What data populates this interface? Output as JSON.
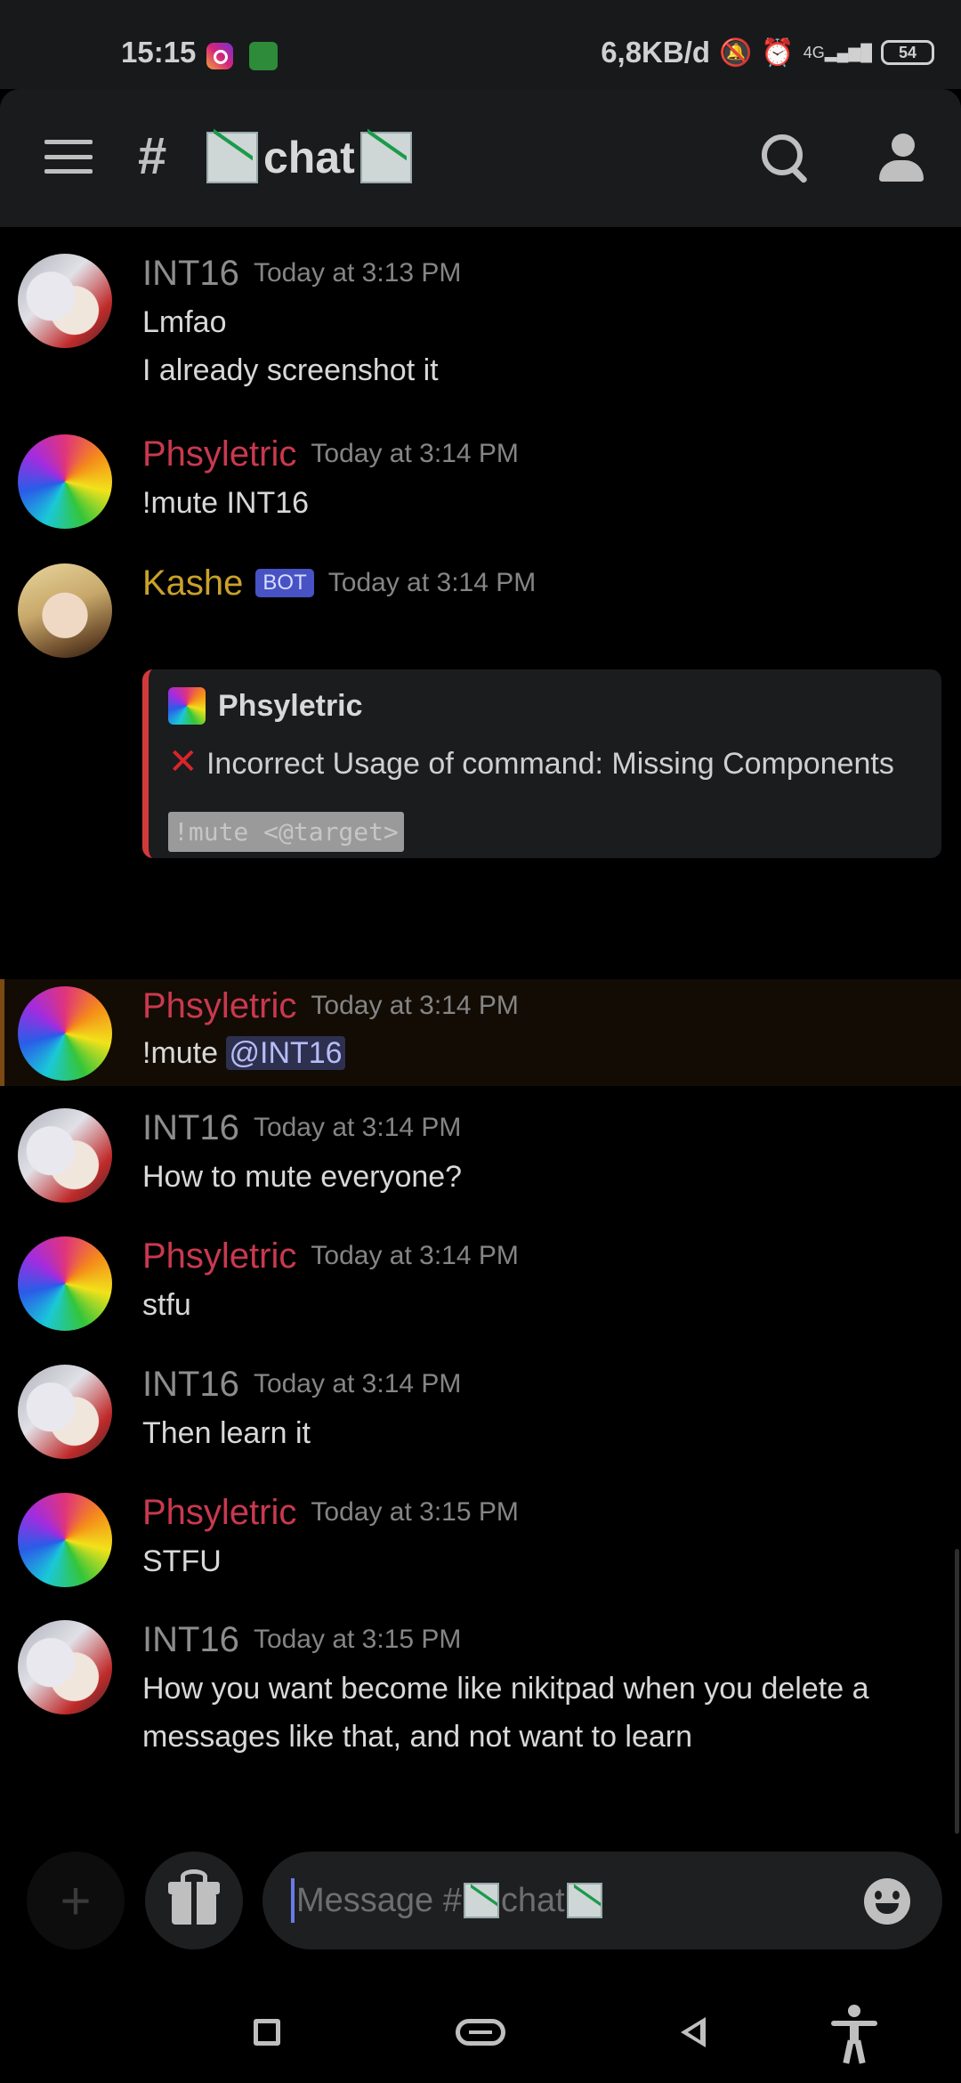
{
  "status_bar": {
    "time": "15:15",
    "net_speed": "6,8KB/d",
    "network": "4G",
    "battery": "54"
  },
  "header": {
    "channel_hash": "#",
    "channel_name": "chat",
    "channel_emoji": "chart-decreasing"
  },
  "messages": [
    {
      "author": "INT16",
      "time": "Today at 3:13 PM",
      "lines": [
        "Lmfao",
        "I already screenshot it"
      ]
    },
    {
      "author": "Phsyletric",
      "time": "Today at 3:14 PM",
      "lines": [
        "!mute INT16"
      ]
    },
    {
      "author": "Kashe",
      "badge": "BOT",
      "time": "Today at 3:14 PM",
      "embed": {
        "author": "Phsyletric",
        "description": "Incorrect Usage of command: Missing Components",
        "code": "!mute <@target>"
      }
    },
    {
      "author": "Phsyletric",
      "time": "Today at 3:14 PM",
      "text_prefix": "!mute ",
      "mention": "@INT16"
    },
    {
      "author": "INT16",
      "time": "Today at 3:14 PM",
      "lines": [
        "How to mute everyone?"
      ]
    },
    {
      "author": "Phsyletric",
      "time": "Today at 3:14 PM",
      "lines": [
        "stfu"
      ]
    },
    {
      "author": "INT16",
      "time": "Today at 3:14 PM",
      "lines": [
        "Then learn it"
      ]
    },
    {
      "author": "Phsyletric",
      "time": "Today at 3:15 PM",
      "lines": [
        "STFU"
      ]
    },
    {
      "author": "INT16",
      "time": "Today at 3:15 PM",
      "lines": [
        "How you want become like nikitpad when you delete a messages like that, and not want to learn"
      ]
    }
  ],
  "input": {
    "placeholder_prefix": "Message #",
    "placeholder_channel": "chat"
  },
  "colors": {
    "int16_name": "#8d8d8d",
    "phsyletric_name": "#c9394e",
    "kashe_name": "#c9a22a",
    "bot_badge": "#4752c4",
    "embed_accent": "#d23a3a"
  }
}
